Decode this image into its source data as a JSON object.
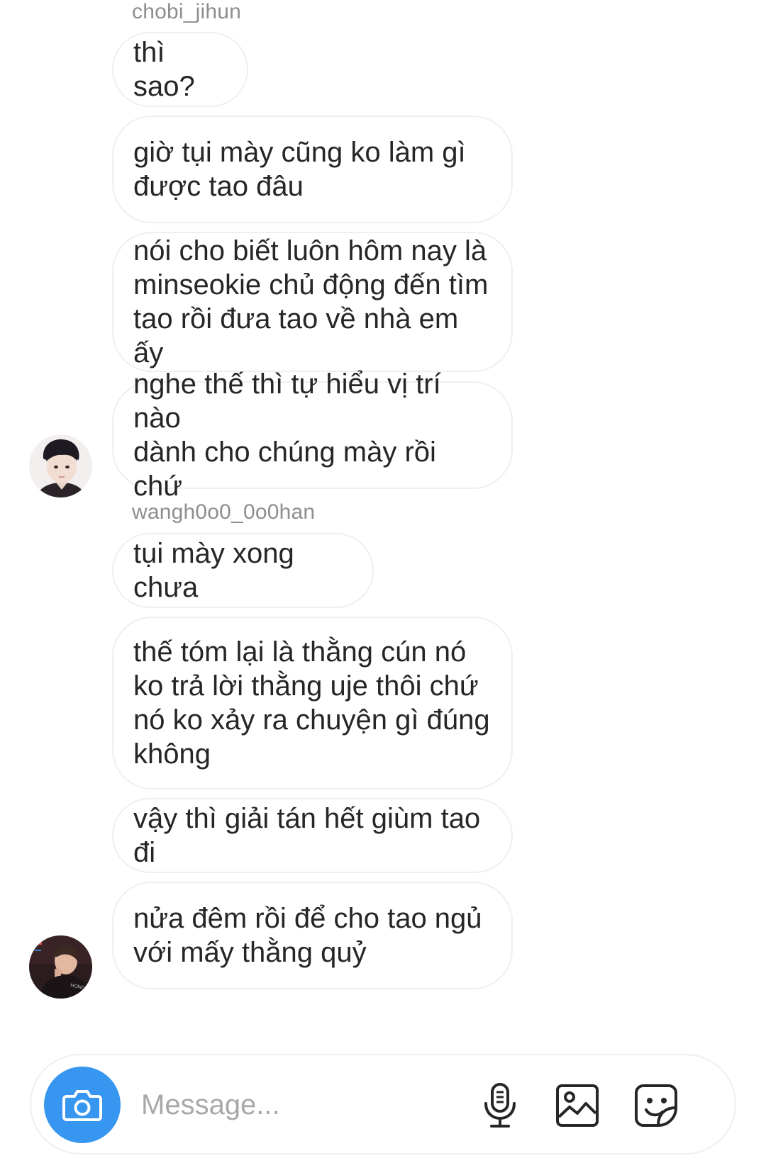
{
  "thread": {
    "groups": [
      {
        "sender": "chobi_jihun",
        "avatar": "profile-avatar-dark-hair-boy",
        "messages": [
          [
            "thì sao?"
          ],
          [
            "giờ tụi mày cũng ko làm gì",
            "được tao đâu"
          ],
          [
            "nói cho biết luôn hôm nay là",
            "minseokie chủ động đến tìm",
            "tao rồi đưa tao về nhà em ấy"
          ],
          [
            "nghe thế thì tự hiểu vị trí nào",
            "dành cho chúng mày rồi chứ"
          ]
        ]
      },
      {
        "sender": "wangh0o0_0o0han",
        "avatar": "profile-avatar-stage-photo",
        "messages": [
          [
            "tụi mày xong chưa"
          ],
          [
            "thế tóm lại là thằng cún nó",
            "ko trả lời thằng uje thôi chứ",
            "nó ko xảy ra chuyện gì đúng",
            "không"
          ],
          [
            "vậy thì giải tán hết giùm tao đi"
          ],
          [
            "nửa đêm rồi để cho tao ngủ",
            "với mấy thằng quỷ"
          ]
        ]
      }
    ]
  },
  "composer": {
    "placeholder": "Message...",
    "value": "",
    "camera_icon": "camera-icon",
    "mic_icon": "microphone-icon",
    "gallery_icon": "gallery-icon",
    "sticker_icon": "sticker-icon",
    "accent_color": "#3797f0"
  }
}
